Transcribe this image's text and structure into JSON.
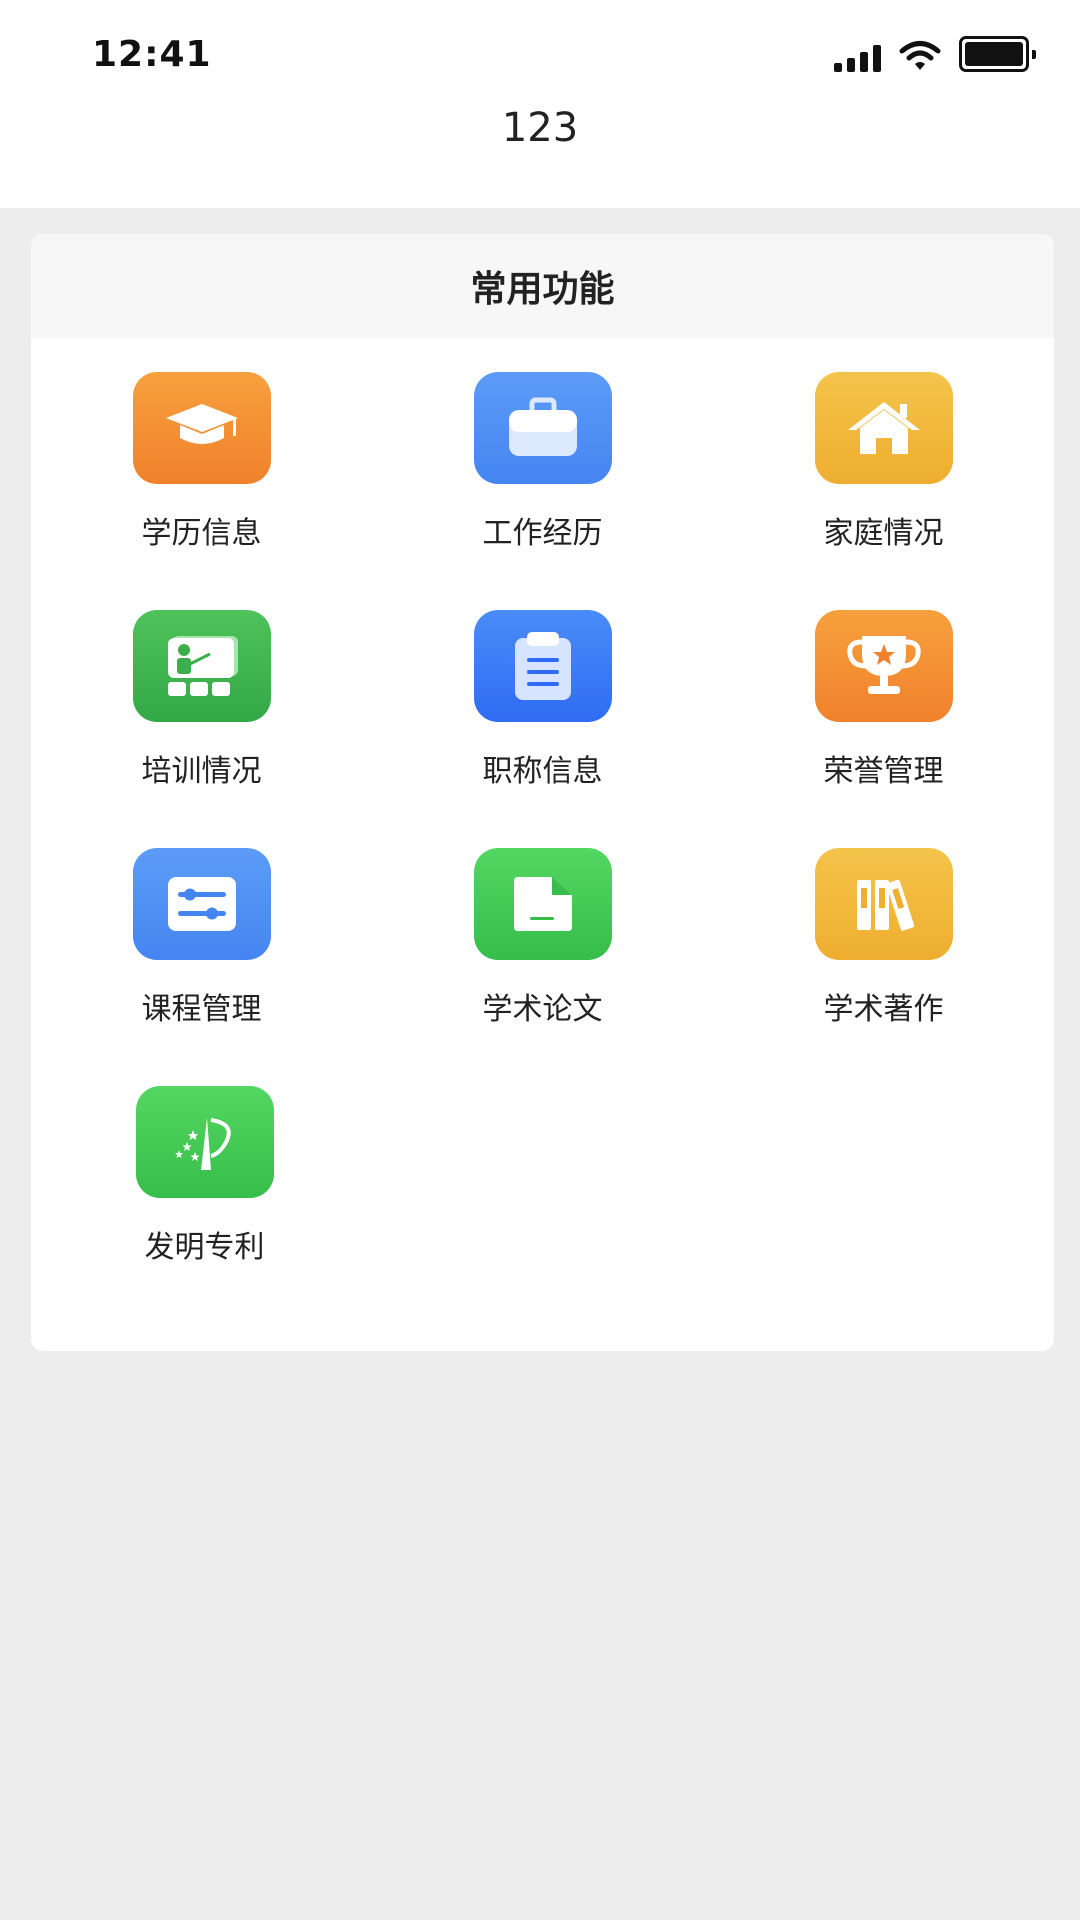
{
  "status_bar": {
    "time": "12:41"
  },
  "nav": {
    "title": "123"
  },
  "section": {
    "title": "常用功能"
  },
  "functions": [
    {
      "label": "学历信息",
      "icon": "graduation-cap-icon",
      "color": "#F1812B"
    },
    {
      "label": "工作经历",
      "icon": "briefcase-icon",
      "color": "#4585F1"
    },
    {
      "label": "家庭情况",
      "icon": "house-icon",
      "color": "#EEAE30"
    },
    {
      "label": "培训情况",
      "icon": "teacher-blackboard-icon",
      "color": "#33A846"
    },
    {
      "label": "职称信息",
      "icon": "clipboard-icon",
      "color": "#2F6CF3"
    },
    {
      "label": "荣誉管理",
      "icon": "trophy-icon",
      "color": "#F1812B"
    },
    {
      "label": "课程管理",
      "icon": "sliders-icon",
      "color": "#4585F1"
    },
    {
      "label": "学术论文",
      "icon": "document-icon",
      "color": "#37BD4A"
    },
    {
      "label": "学术著作",
      "icon": "books-icon",
      "color": "#EEAE30"
    },
    {
      "label": "发明专利",
      "icon": "patent-icon",
      "color": "#37BD4A"
    }
  ]
}
